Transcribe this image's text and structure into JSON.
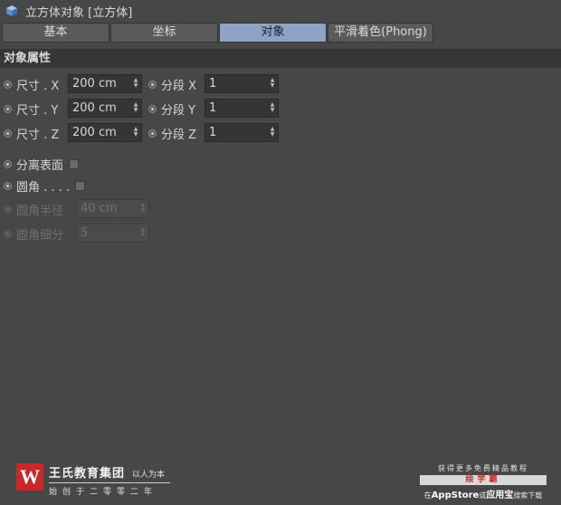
{
  "title": "立方体对象 [立方体]",
  "tabs": [
    {
      "label": "基本",
      "active": false
    },
    {
      "label": "坐标",
      "active": false
    },
    {
      "label": "对象",
      "active": true
    },
    {
      "label": "平滑着色(Phong)",
      "active": false
    }
  ],
  "section_title": "对象属性",
  "size_rows": [
    {
      "label": "尺寸 . X",
      "value": "200 cm",
      "seg_label": "分段 X",
      "seg_value": "1"
    },
    {
      "label": "尺寸 . Y",
      "value": "200 cm",
      "seg_label": "分段 Y",
      "seg_value": "1"
    },
    {
      "label": "尺寸 . Z",
      "value": "200 cm",
      "seg_label": "分段 Z",
      "seg_value": "1"
    }
  ],
  "separate_surfaces": {
    "label": "分离表面",
    "checked": false
  },
  "fillet": {
    "label": "圆角 . . . .",
    "checked": false
  },
  "fillet_radius": {
    "label": "圆角半径",
    "value": "40 cm",
    "enabled": false
  },
  "fillet_subdivision": {
    "label": "圆角细分",
    "value": "5",
    "enabled": false
  },
  "footer": {
    "logo_letter": "W",
    "brand_name": "王氏教育集团",
    "slogan": "以人为本",
    "sub": "始创于二零零二年",
    "right_top": "获得更多免费精品教程",
    "right_badge": "绘学霸",
    "right_prefix": "在",
    "right_appstore": "AppStore",
    "right_or": "或",
    "right_store2": "应用宝",
    "right_suffix": "搜索下载"
  },
  "colors": {
    "background": "#474747",
    "active_tab": "#8fa3c6",
    "header": "#363636",
    "logo": "#c8282a"
  }
}
